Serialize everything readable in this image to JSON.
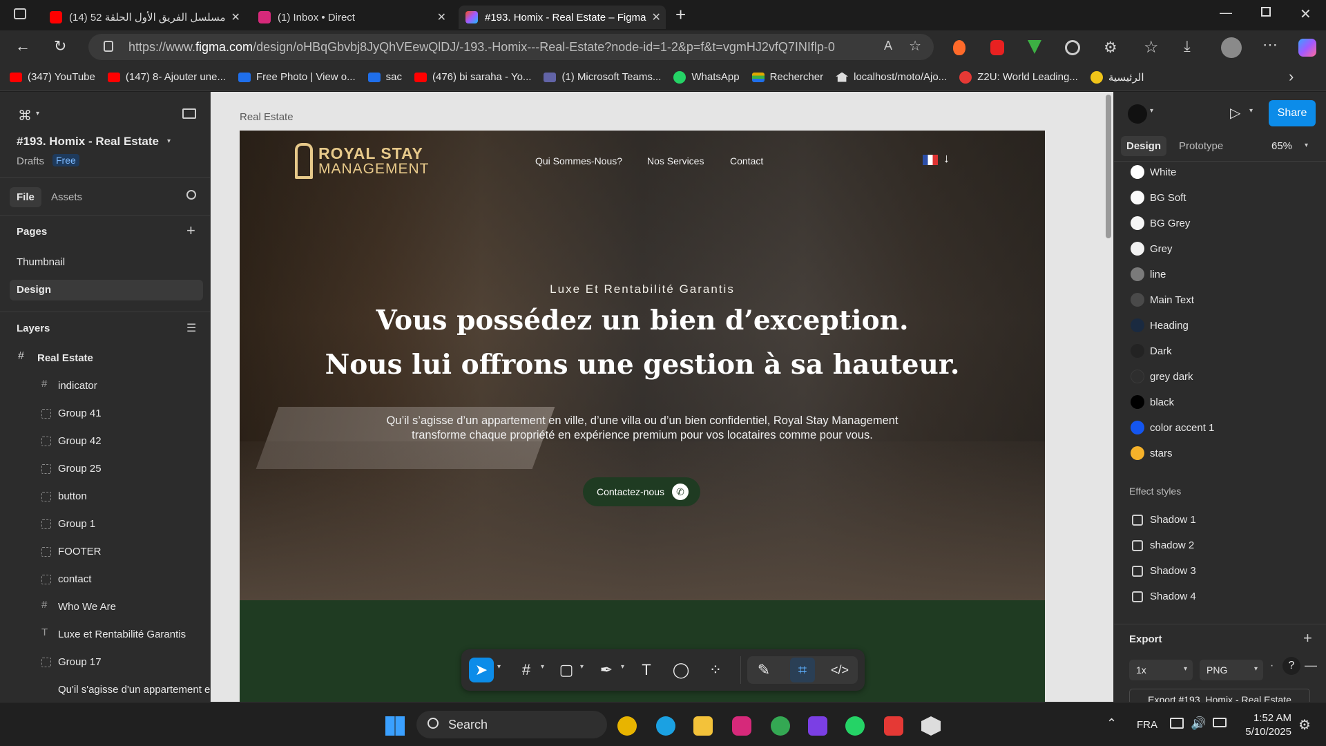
{
  "browser": {
    "tabs": [
      {
        "title": "(14) مسلسل الفريق الأول الحلقة 52",
        "icon_color": "#ff0000",
        "active": false
      },
      {
        "title": "(1) Inbox • Direct",
        "icon_color": "#d6297a",
        "active": false
      },
      {
        "title": "#193. Homix - Real Estate – Figma",
        "icon_color": "#a259ff",
        "active": true
      }
    ],
    "new_tab_label": "+",
    "url_prefix": "https://www.",
    "url_domain": "figma.com",
    "url_rest": "/design/oHBqGbvbj8JyQhVEewQlDJ/-193.-Homix---Real-Estate?node-id=1-2&p=f&t=vgmHJ2vfQ7INIflp-0",
    "bookmarks": [
      {
        "label": "(347) YouTube",
        "color": "#ff0000"
      },
      {
        "label": "(147) 8- Ajouter une...",
        "color": "#ff0000"
      },
      {
        "label": "Free Photo | View o...",
        "color": "#1f6feb"
      },
      {
        "label": "sac",
        "color": "#1f6feb"
      },
      {
        "label": "(476) bi saraha - Yo...",
        "color": "#ff0000"
      },
      {
        "label": "(1) Microsoft Teams...",
        "color": "#6264a7"
      },
      {
        "label": "WhatsApp",
        "color": "#25d366"
      },
      {
        "label": "Rechercher",
        "color": "#e0a800"
      },
      {
        "label": "localhost/moto/Ajo...",
        "color": "#dddddd"
      },
      {
        "label": "Z2U: World Leading...",
        "color": "#e53935"
      },
      {
        "label": "الرئيسية",
        "color": "#f0c419"
      }
    ]
  },
  "figma_left": {
    "file_title": "#193. Homix - Real Estate",
    "drafts_label": "Drafts",
    "plan_badge": "Free",
    "tab_file": "File",
    "tab_assets": "Assets",
    "pages_heading": "Pages",
    "pages": [
      "Thumbnail",
      "Design"
    ],
    "layers_heading": "Layers",
    "root_layer": "Real Estate",
    "layers": [
      "indicator",
      "Group 41",
      "Group 42",
      "Group 25",
      "button",
      "Group 1",
      "FOOTER",
      "contact",
      "Who We Are",
      "Luxe et Rentabilité Garantis",
      "Group 17",
      "Qu'il s'agisse d'un appartement en"
    ]
  },
  "canvas": {
    "frame_label": "Real Estate",
    "site": {
      "logo_line1": "ROYAL STAY",
      "logo_line2": "MANAGEMENT",
      "nav": [
        "Qui Sommes-Nous?",
        "Nos Services",
        "Contact"
      ],
      "kicker": "Luxe Et Rentabilité Garantis",
      "headline1": "Vous possédez un bien d’exception.",
      "headline2": "Nous lui offrons une gestion à sa hauteur.",
      "subtext": "Qu’il s’agisse d’un appartement en ville, d’une villa ou d’un bien confidentiel, Royal Stay Management transforme chaque propriété en expérience premium pour vos locataires comme pour vous.",
      "cta": "Contactez-nous",
      "accent_gold": "#e7c98a",
      "brand_green": "#1f3b22"
    }
  },
  "figma_right": {
    "share_label": "Share",
    "tab_design": "Design",
    "tab_prototype": "Prototype",
    "zoom": "65%",
    "colors": [
      {
        "name": "White",
        "hex": "#ffffff"
      },
      {
        "name": "BG Soft",
        "hex": "#fbfbfb"
      },
      {
        "name": "BG Grey",
        "hex": "#f6f6f6"
      },
      {
        "name": "Grey",
        "hex": "#f2f2f2"
      },
      {
        "name": "line",
        "hex": "#7a7a7a"
      },
      {
        "name": "Main Text",
        "hex": "#4a4a4a"
      },
      {
        "name": "Heading",
        "hex": "#1a2a40"
      },
      {
        "name": "Dark",
        "hex": "#232323"
      },
      {
        "name": "grey dark",
        "hex": "#2e2e2e"
      },
      {
        "name": "black",
        "hex": "#000000"
      },
      {
        "name": "color accent 1",
        "hex": "#1456f0"
      },
      {
        "name": "stars",
        "hex": "#f6b22a"
      }
    ],
    "effect_styles_heading": "Effect styles",
    "effects": [
      "Shadow 1",
      "shadow 2",
      "Shadow 3",
      "Shadow 4"
    ],
    "export_heading": "Export",
    "export_scale": "1x",
    "export_format": "PNG",
    "export_button": "Export #193. Homix - Real Estate"
  },
  "taskbar": {
    "search_placeholder": "Search",
    "language": "FRA",
    "time": "1:52 AM",
    "date": "5/10/2025",
    "icons": [
      {
        "name": "chrome",
        "color": "#e8b400"
      },
      {
        "name": "edge",
        "color": "#1ba1e2"
      },
      {
        "name": "file-explorer",
        "color": "#f3c23a"
      },
      {
        "name": "instagram",
        "color": "#d6297a"
      },
      {
        "name": "chrome-2",
        "color": "#34a853"
      },
      {
        "name": "app-purple",
        "color": "#7b3fe4"
      },
      {
        "name": "whatsapp",
        "color": "#25d366"
      },
      {
        "name": "app-red",
        "color": "#e53935"
      },
      {
        "name": "app-cube",
        "color": "#dddddd"
      }
    ]
  }
}
